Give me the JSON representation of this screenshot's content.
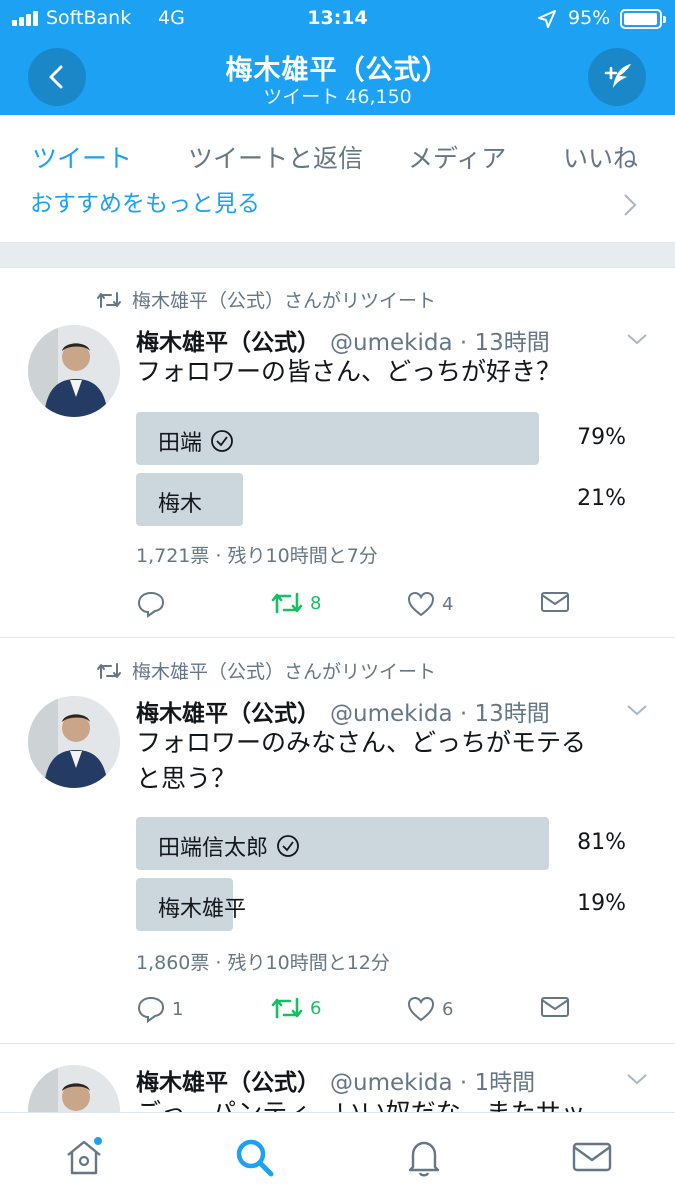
{
  "status_bar": {
    "carrier": "SoftBank",
    "network": "4G",
    "time": "13:14",
    "battery": "95%"
  },
  "header": {
    "title": "梅木雄平（公式）",
    "subtitle": "ツイート 46,150"
  },
  "tabs": [
    {
      "label": "ツイート",
      "active": true
    },
    {
      "label": "ツイートと返信",
      "active": false
    },
    {
      "label": "メディア",
      "active": false
    },
    {
      "label": "いいね",
      "active": false
    }
  ],
  "see_more": "おすすめをもっと見る",
  "tweets": [
    {
      "retweet_note": "梅木雄平（公式）さんがリツイート",
      "name": "梅木雄平（公式）",
      "handle_time": "@umekida · 13時間",
      "text_lines": [
        "フォロワーの皆さん、どっちが好き？"
      ],
      "poll": [
        {
          "label": "田端",
          "percent": "79%",
          "value": 0.79,
          "checked": true
        },
        {
          "label": "梅木",
          "percent": "21%",
          "value": 0.21,
          "checked": false
        }
      ],
      "poll_meta": "1,721票 · 残り10時間と7分",
      "reply_count": "",
      "retweet_count": "8",
      "like_count": "4"
    },
    {
      "retweet_note": "梅木雄平（公式）さんがリツイート",
      "name": "梅木雄平（公式）",
      "handle_time": "@umekida · 13時間",
      "text_lines": [
        "フォロワーのみなさん、どっちがモテる",
        "と思う？"
      ],
      "poll": [
        {
          "label": "田端信太郎",
          "percent": "81%",
          "value": 0.81,
          "checked": true
        },
        {
          "label": "梅木雄平",
          "percent": "19%",
          "value": 0.19,
          "checked": false
        }
      ],
      "poll_meta": "1,860票 · 残り10時間と12分",
      "reply_count": "1",
      "retweet_count": "6",
      "like_count": "6"
    },
    {
      "name": "梅木雄平（公式）",
      "handle_time": "@umekida · 1時間",
      "text_partial": "ごっ　パンティ　いい奴だな　またサッ"
    }
  ],
  "colors": {
    "brand": "#1da1f2",
    "retweet_green": "#17bf63",
    "muted": "#657786",
    "poll_bar": "#ccd6dd"
  },
  "icons": [
    "back-arrow-icon",
    "compose-icon",
    "chevron-right-icon",
    "retweet-icon",
    "reply-icon",
    "like-icon",
    "dm-icon",
    "home-icon",
    "search-icon",
    "notifications-icon",
    "messages-icon"
  ]
}
